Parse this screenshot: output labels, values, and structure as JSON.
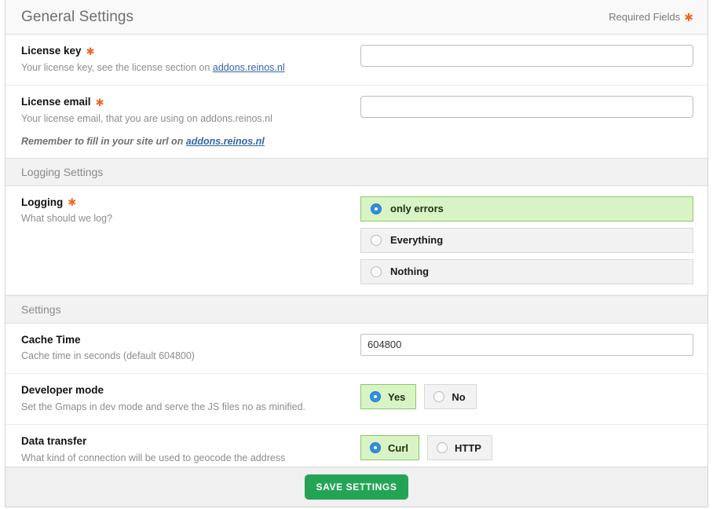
{
  "header": {
    "title": "General Settings",
    "required_note": "Required Fields",
    "required_marker": "✱"
  },
  "general": {
    "license_key": {
      "label": "License key",
      "required_marker": "✱",
      "desc_prefix": "Your license key, see the license section on ",
      "link": "addons.reinos.nl",
      "value": "",
      "placeholder": ""
    },
    "license_email": {
      "label": "License email",
      "required_marker": "✱",
      "desc": "Your license email, that you are using on addons.reinos.nl",
      "value": "",
      "placeholder": ""
    },
    "reminder_prefix": "Remember to fill in your site url on ",
    "reminder_link": "addons.reinos.nl"
  },
  "logging_section": {
    "heading": "Logging Settings",
    "logging": {
      "label": "Logging",
      "required_marker": "✱",
      "desc": "What should we log?",
      "options": [
        {
          "label": "only errors",
          "selected": true
        },
        {
          "label": "Everything",
          "selected": false
        },
        {
          "label": "Nothing",
          "selected": false
        }
      ]
    }
  },
  "settings_section": {
    "heading": "Settings",
    "cache_time": {
      "label": "Cache Time",
      "desc": "Cache time in seconds (default 604800)",
      "value": "604800",
      "placeholder": ""
    },
    "developer_mode": {
      "label": "Developer mode",
      "desc": "Set the Gmaps in dev mode and serve the JS files no as minified.",
      "options": [
        {
          "label": "Yes",
          "selected": true
        },
        {
          "label": "No",
          "selected": false
        }
      ]
    },
    "data_transfer": {
      "label": "Data transfer",
      "desc": "What kind of connection will be used to geocode the address",
      "options": [
        {
          "label": "Curl",
          "selected": true
        },
        {
          "label": "HTTP",
          "selected": false
        }
      ]
    }
  },
  "footer": {
    "save_label": "SAVE SETTINGS"
  },
  "colors": {
    "accent_required": "#f26522",
    "link": "#3464a8",
    "selected_bg": "#d8f4c4",
    "selected_border": "#8dc76a",
    "radio_on": "#2f8fe0",
    "save_button": "#23a455"
  }
}
